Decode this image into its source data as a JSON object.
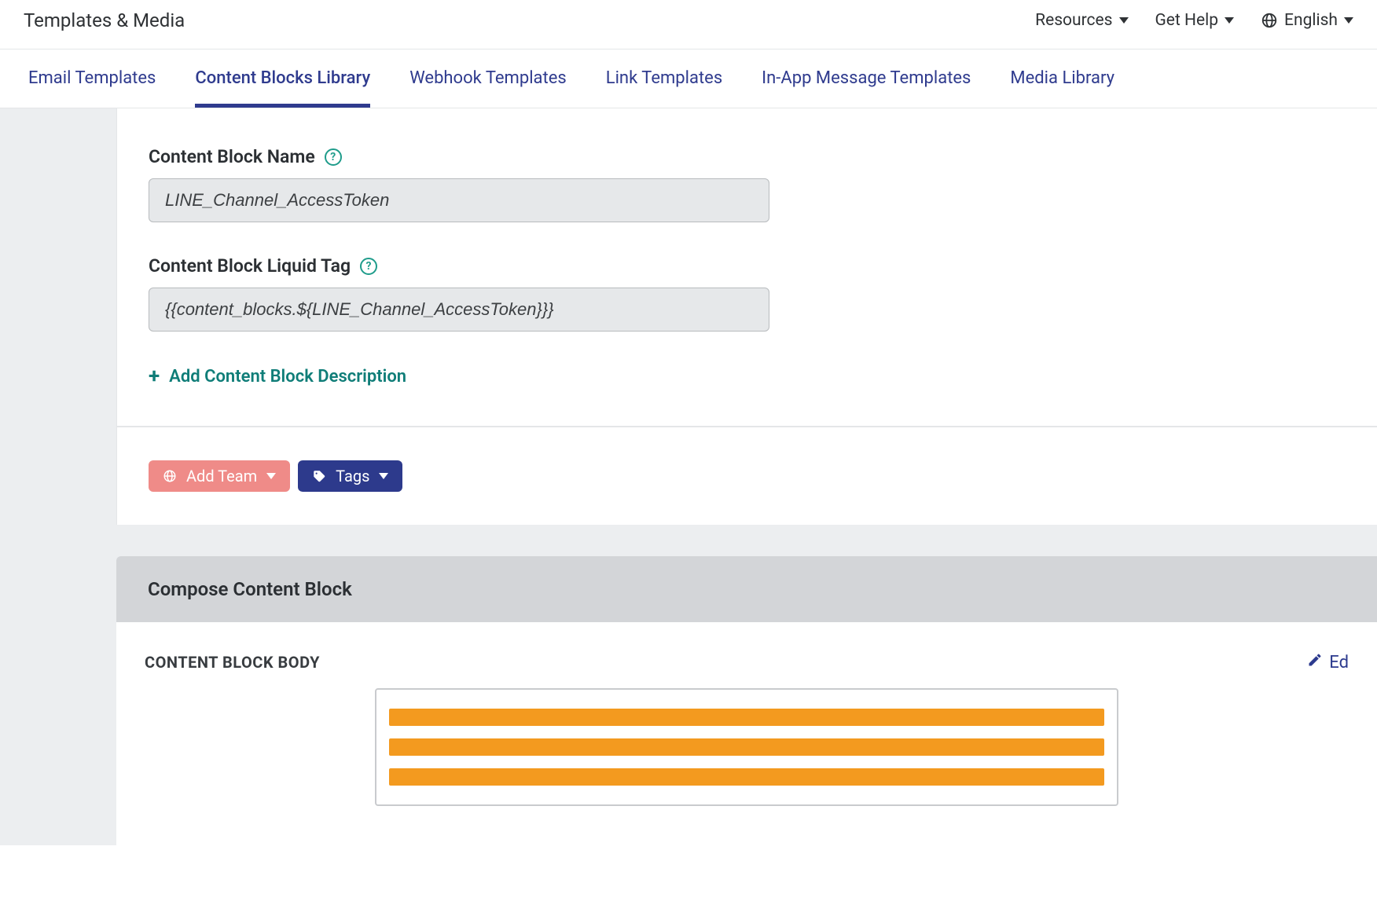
{
  "header": {
    "title": "Templates & Media",
    "resources": "Resources",
    "get_help": "Get Help",
    "language": "English"
  },
  "tabs": {
    "email": "Email Templates",
    "content_blocks": "Content Blocks Library",
    "webhook": "Webhook Templates",
    "link": "Link Templates",
    "inapp": "In-App Message Templates",
    "media": "Media Library"
  },
  "form": {
    "name_label": "Content Block Name",
    "name_value": "LINE_Channel_AccessToken",
    "liquid_label": "Content Block Liquid Tag",
    "liquid_value": "{{content_blocks.${LINE_Channel_AccessToken}}}",
    "add_desc": "Add Content Block Description"
  },
  "buttons": {
    "add_team": "Add Team",
    "tags": "Tags"
  },
  "compose": {
    "title": "Compose Content Block",
    "body_label": "CONTENT BLOCK BODY",
    "edit": "Ed"
  }
}
